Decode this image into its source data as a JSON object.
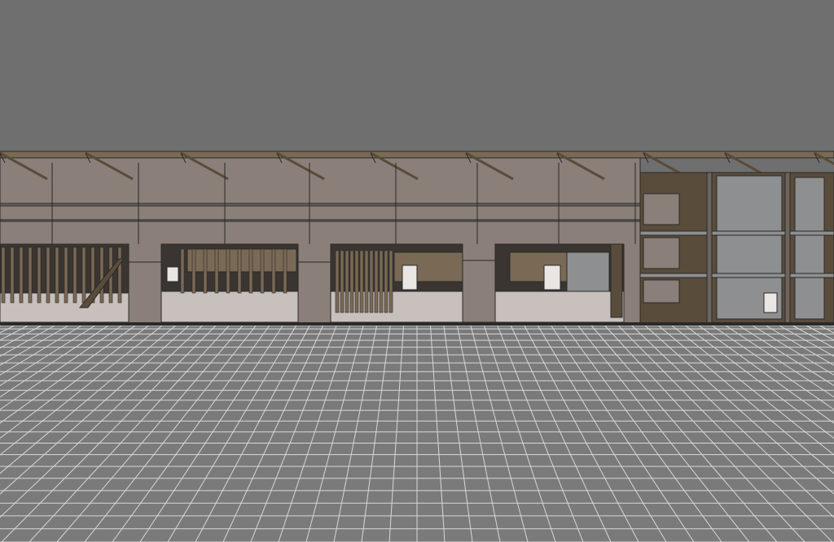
{
  "viewport": {
    "sky_color": "#6f6f6f",
    "ground_color": "#7a7a7a",
    "grid_line_color": "#d8d8d8",
    "model_colors": {
      "wall": "#8a7f79",
      "wall_dark": "#6e645e",
      "wood": "#7a6a55",
      "wood_dark": "#5a4c3b",
      "floor": "#c7c0bc",
      "interior_shadow": "#3a3530",
      "concrete": "#8d8f91",
      "outline": "#2a2a2a",
      "opening": "#e9e6e4"
    }
  }
}
